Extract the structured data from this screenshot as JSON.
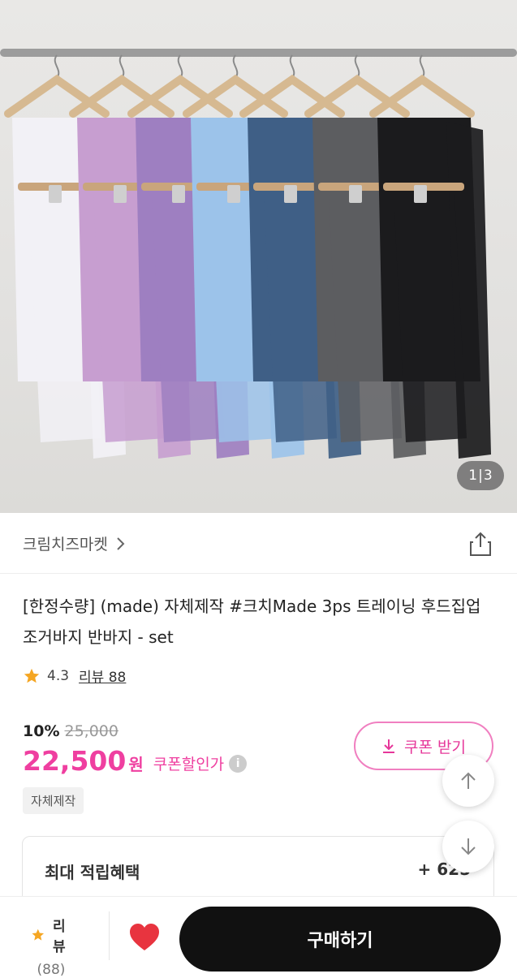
{
  "hero": {
    "pager_current": "1",
    "pager_sep": "|",
    "pager_total": "3",
    "garment_colors": [
      "#f2f1f6",
      "#c79ed0",
      "#9e7fc1",
      "#9cc3ea",
      "#3f5f86",
      "#5c5d60",
      "#1b1b1d"
    ]
  },
  "seller": {
    "name": "크림치즈마켓"
  },
  "product": {
    "title": "[한정수량] (made) 자체제작 #크치Made 3ps 트레이닝 후드집업 조거바지 반바지 - set",
    "rating": "4.3",
    "review_label": "리뷰 88",
    "discount_rate": "10%",
    "original_price": "25,000",
    "price": "22,500",
    "currency": "원",
    "coupon_price_label": "쿠폰할인가",
    "tag": "자체제작"
  },
  "coupon_button": {
    "label": "쿠폰 받기"
  },
  "benefit": {
    "label": "최대 적립혜택",
    "value": "+ 625"
  },
  "bottom": {
    "review_label": "리뷰",
    "review_count": "(88)",
    "buy_label": "구매하기"
  },
  "colors": {
    "accent_pink": "#ef3fa0",
    "heart_red": "#e8343f",
    "star_orange": "#f5a623",
    "buy_button": "#111111"
  }
}
